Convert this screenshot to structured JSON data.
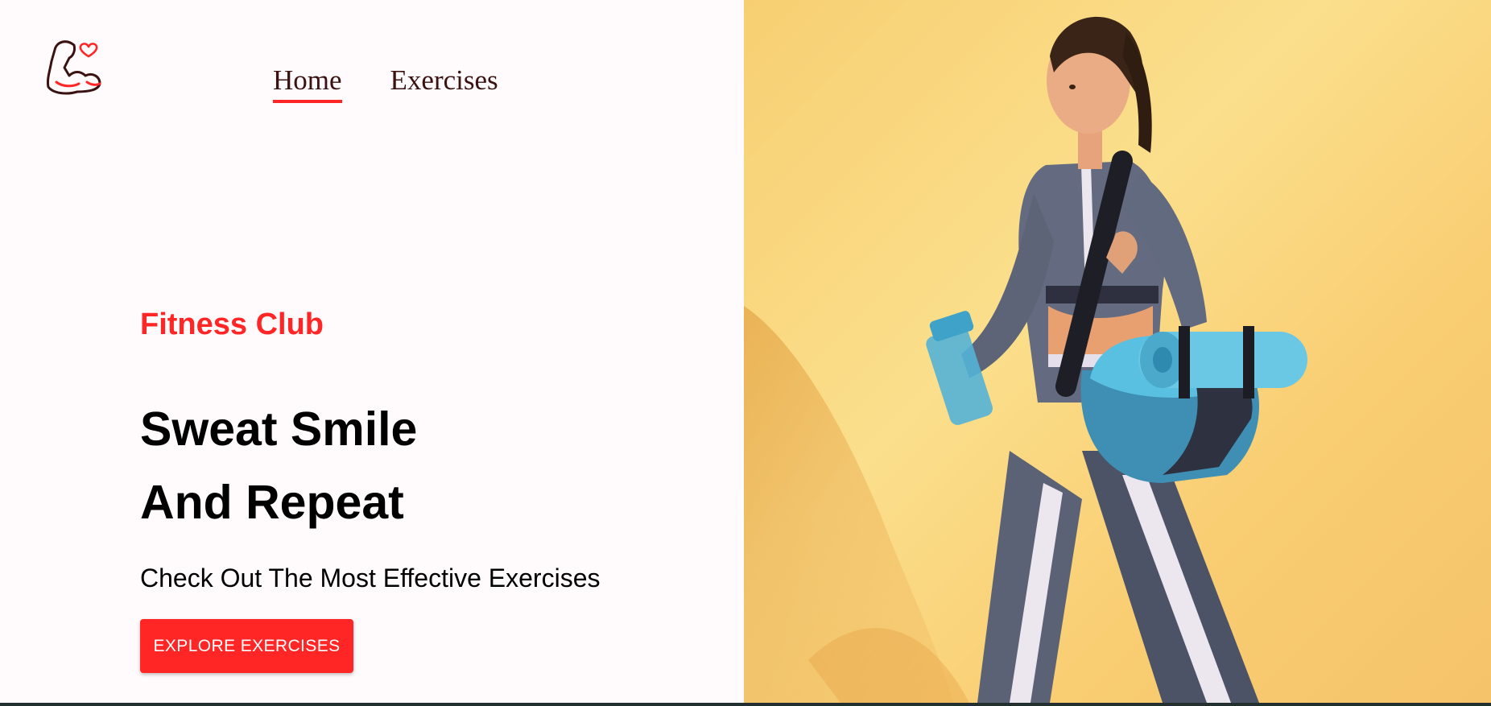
{
  "nav": {
    "items": [
      {
        "label": "Home",
        "active": true
      },
      {
        "label": "Exercises",
        "active": false
      }
    ]
  },
  "hero": {
    "eyebrow": "Fitness Club",
    "title_line1": "Sweat Smile",
    "title_line2": "And Repeat",
    "subtitle": "Check Out The Most Effective Exercises",
    "cta_label": "EXPLORE EXERCISES"
  },
  "banner": {
    "alt": "woman walking with shaker bottle, gym bag and yoga mat"
  },
  "icons": {
    "logo": "flexed-arm-heart-icon"
  },
  "colors": {
    "accent": "#ff2625",
    "background": "#fffafb",
    "banner_yellow": "#fbdf8c",
    "text_dark": "#3a1212"
  }
}
